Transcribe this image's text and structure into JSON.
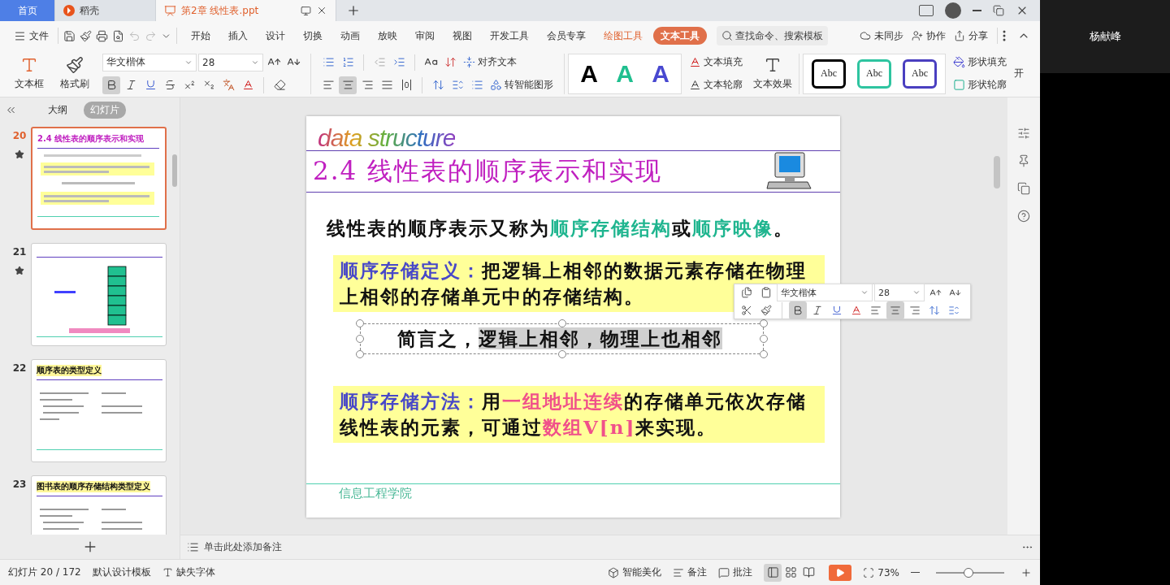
{
  "tabs": [
    {
      "label": "首页",
      "kind": "home",
      "selected": false
    },
    {
      "label": "稻壳",
      "kind": "docer",
      "selected": false
    },
    {
      "label": "第2章 线性表.ppt",
      "kind": "doc",
      "selected": true
    }
  ],
  "menu": {
    "file": "文件",
    "tabs": [
      {
        "label": "开始",
        "kind": "normal",
        "selected": false
      },
      {
        "label": "插入",
        "kind": "normal",
        "selected": false
      },
      {
        "label": "设计",
        "kind": "normal",
        "selected": false
      },
      {
        "label": "切换",
        "kind": "normal",
        "selected": false
      },
      {
        "label": "动画",
        "kind": "normal",
        "selected": false
      },
      {
        "label": "放映",
        "kind": "normal",
        "selected": false
      },
      {
        "label": "审阅",
        "kind": "normal",
        "selected": false
      },
      {
        "label": "视图",
        "kind": "normal",
        "selected": false
      },
      {
        "label": "开发工具",
        "kind": "normal",
        "selected": false
      },
      {
        "label": "会员专享",
        "kind": "normal",
        "selected": false
      },
      {
        "label": "绘图工具",
        "kind": "context",
        "selected": false
      },
      {
        "label": "文本工具",
        "kind": "context",
        "selected": true
      }
    ],
    "search": {
      "placeholder": "查找命令、搜索模板"
    },
    "actions": [
      {
        "label": "未同步",
        "kind": "sync"
      },
      {
        "label": "协作",
        "kind": "collab"
      },
      {
        "label": "分享",
        "kind": "share"
      }
    ]
  },
  "ribbon": {
    "text_box": "文本框",
    "format_painter": "格式刷",
    "font": "华文楷体",
    "size": "28",
    "bold": true,
    "aligns": [
      {
        "kind": "left",
        "selected": false
      },
      {
        "kind": "center",
        "selected": true
      },
      {
        "kind": "right",
        "selected": false
      },
      {
        "kind": "justify",
        "selected": false
      },
      {
        "kind": "distributed",
        "selected": false
      }
    ],
    "align_text": "对齐文本",
    "smart_art": "转智能图形",
    "text_styles": [
      {
        "label": "A",
        "color": "#000000"
      },
      {
        "label": "A",
        "color": "#1fbf8f"
      },
      {
        "label": "A",
        "color": "#4848d0"
      }
    ],
    "text_fill": "文本填充",
    "text_outline": "文本轮廓",
    "text_effect": "文本效果",
    "shape_styles": [
      {
        "label": "Abc",
        "color": "#000000"
      },
      {
        "label": "Abc",
        "color": "#2ec4a0"
      },
      {
        "label": "Abc",
        "color": "#4a3fc0"
      }
    ],
    "shape_fill": "形状填充",
    "shape_outline": "形状轮廓",
    "cut_off": "开"
  },
  "panel_tabs": [
    {
      "label": "大纲",
      "selected": false
    },
    {
      "label": "幻灯片",
      "selected": true
    }
  ],
  "thumbnails": [
    {
      "number": "20",
      "starred": true,
      "selected": true,
      "kind": "text",
      "title": "2.4 线性表的顺序表示和实现"
    },
    {
      "number": "21",
      "starred": true,
      "selected": false,
      "kind": "diagram"
    },
    {
      "number": "22",
      "starred": false,
      "selected": false,
      "kind": "code",
      "title": "顺序表的类型定义"
    },
    {
      "number": "23",
      "starred": false,
      "selected": false,
      "kind": "code",
      "title": "图书表的顺序存储结构类型定义"
    }
  ],
  "slide": {
    "banner": "data structure",
    "title": "2.4 线性表的顺序表示和实现",
    "intro": [
      {
        "text": "线性表的顺序表示又称为",
        "kind": "plain"
      },
      {
        "text": "顺序存储结构",
        "kind": "term"
      },
      {
        "text": "或",
        "kind": "plain"
      },
      {
        "text": "顺序映像",
        "kind": "term"
      },
      {
        "text": "。",
        "kind": "plain"
      }
    ],
    "definition": [
      {
        "text": "顺序存储定义：",
        "kind": "label"
      },
      {
        "text": "把逻辑上相邻的数据元素存储在物理上相邻的存储单元中的存储结构。",
        "kind": "plain"
      }
    ],
    "summary": [
      {
        "text": "简言之，",
        "kind": "plain"
      },
      {
        "text": "逻辑上相邻，物理上也相邻",
        "kind": "selected"
      }
    ],
    "method": [
      {
        "text": "顺序存储方法：",
        "kind": "label"
      },
      {
        "text": "用",
        "kind": "plain"
      },
      {
        "text": "一组地址连续",
        "kind": "accent"
      },
      {
        "text": "的存储单元依次存储线性表的元素，可通过",
        "kind": "plain"
      },
      {
        "text": "数组V[n]",
        "kind": "accent"
      },
      {
        "text": "来实现。",
        "kind": "plain"
      }
    ],
    "footer": "信息工程学院"
  },
  "mini_toolbar": {
    "font": "华文楷体",
    "size": "28",
    "bold": true,
    "aligns": [
      {
        "kind": "left",
        "selected": false
      },
      {
        "kind": "center",
        "selected": true
      },
      {
        "kind": "right",
        "selected": false
      }
    ]
  },
  "notes": {
    "placeholder": "单击此处添加备注"
  },
  "status": {
    "slide": "幻灯片 20 / 172",
    "template": "默认设计模板",
    "missing_fonts": "缺失字体",
    "beautify": "智能美化",
    "notes": "备注",
    "comments": "批注",
    "views": [
      {
        "kind": "normal",
        "selected": true
      },
      {
        "kind": "sorter",
        "selected": false
      },
      {
        "kind": "reading",
        "selected": false
      }
    ],
    "zoom": {
      "reading": "73%",
      "level": 0.48
    }
  },
  "participant": {
    "name": "杨献峰"
  }
}
